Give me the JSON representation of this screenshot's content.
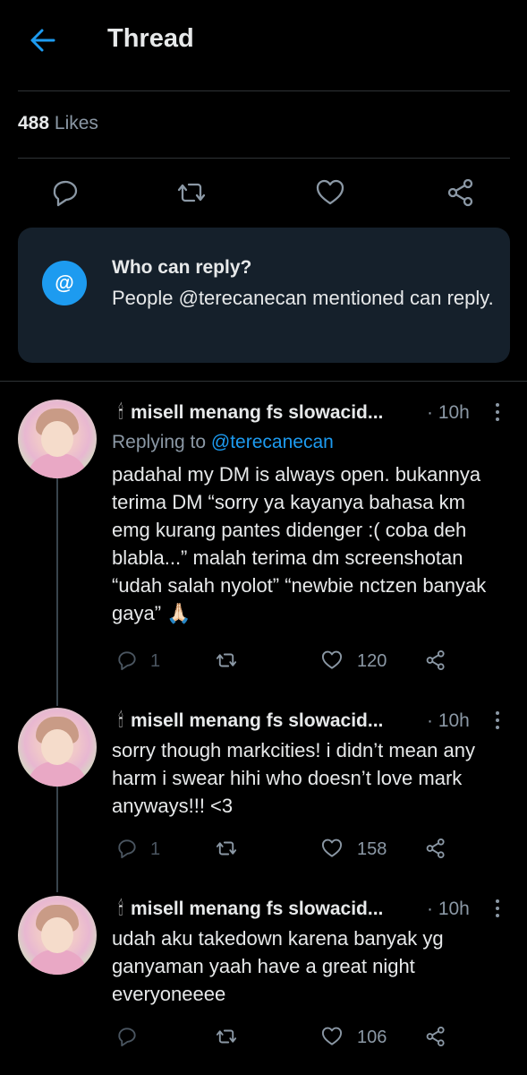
{
  "header": {
    "title": "Thread"
  },
  "stats": {
    "likes_count": "488",
    "likes_label": "Likes"
  },
  "who_can_reply": {
    "icon": "@",
    "title": "Who can reply?",
    "body": "People @terecanecan mentioned can reply."
  },
  "tweets": [
    {
      "author": "misell menang fs slowacid...",
      "time": "· 10h",
      "replying_prefix": "Replying to",
      "replying_handle": "@terecanecan",
      "text": "padahal my DM is always open. bukannya terima DM “sorry ya kayanya bahasa km emg kurang pantes didenger :( coba deh blabla...” malah terima dm screenshotan “udah salah nyolot” “newbie nctzen banyak gaya” 🙏🏻",
      "replies": "1",
      "likes": "120"
    },
    {
      "author": "misell menang fs slowacid...",
      "time": "· 10h",
      "text": "sorry though markcities! i didn’t mean any harm i swear hihi who doesn’t love mark anyways!!! <3",
      "replies": "1",
      "likes": "158"
    },
    {
      "author": "misell menang fs slowacid...",
      "time": "· 10h",
      "text": "udah aku takedown karena banyak yg ganyaman yaah have a great night everyoneeee",
      "likes": "106"
    }
  ],
  "colors": {
    "accent": "#1d9bf0",
    "background": "#000000",
    "card": "#15202b",
    "muted": "#8b98a5"
  }
}
